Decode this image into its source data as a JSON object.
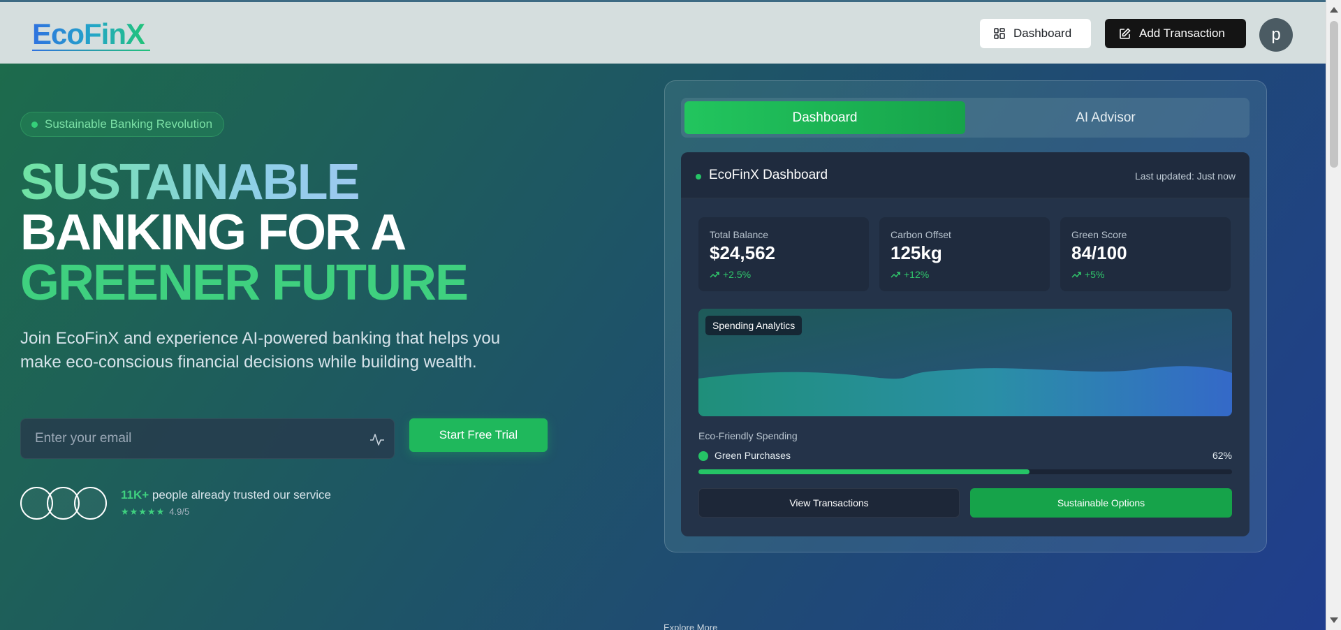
{
  "header": {
    "logo": "EcoFinX",
    "dashboard_label": "Dashboard",
    "add_transaction_label": "Add Transaction",
    "avatar_initial": "p"
  },
  "hero": {
    "badge": "Sustainable Banking Revolution",
    "headline_1": "SUSTAINABLE",
    "headline_2": "BANKING FOR A",
    "headline_3": "GREENER FUTURE",
    "subtitle": "Join EcoFinX and experience AI-powered banking that helps you make eco-conscious financial decisions while building wealth.",
    "email_placeholder": "Enter your email",
    "cta_label": "Start Free Trial",
    "trust_count": "11K+",
    "trust_text": "people already trusted our service",
    "stars": "★★★★★",
    "rating": "4.9/5",
    "explore": "Explore More"
  },
  "dashboard": {
    "tabs": [
      {
        "label": "Dashboard",
        "active": true
      },
      {
        "label": "AI Advisor",
        "active": false
      }
    ],
    "title": "EcoFinX Dashboard",
    "last_updated": "Last updated: Just now",
    "stats": [
      {
        "label": "Total Balance",
        "value": "$24,562",
        "change": "+2.5%"
      },
      {
        "label": "Carbon Offset",
        "value": "125kg",
        "change": "+12%"
      },
      {
        "label": "Green Score",
        "value": "84/100",
        "change": "+5%"
      }
    ],
    "chart_label": "Spending Analytics",
    "eco_label": "Eco-Friendly Spending",
    "green_purchases_label": "Green Purchases",
    "green_purchases_pct": "62%",
    "green_purchases_value": 0.62,
    "view_transactions_label": "View Transactions",
    "sustainable_options_label": "Sustainable Options"
  },
  "colors": {
    "accent_green": "#22c55e",
    "brand_blue": "#2f72e0",
    "header_bg": "#d5dede"
  },
  "icons": {
    "dashboard": "grid-icon",
    "add_transaction": "edit-icon",
    "email_field": "activity-icon",
    "stat_change": "trending-up-icon"
  }
}
